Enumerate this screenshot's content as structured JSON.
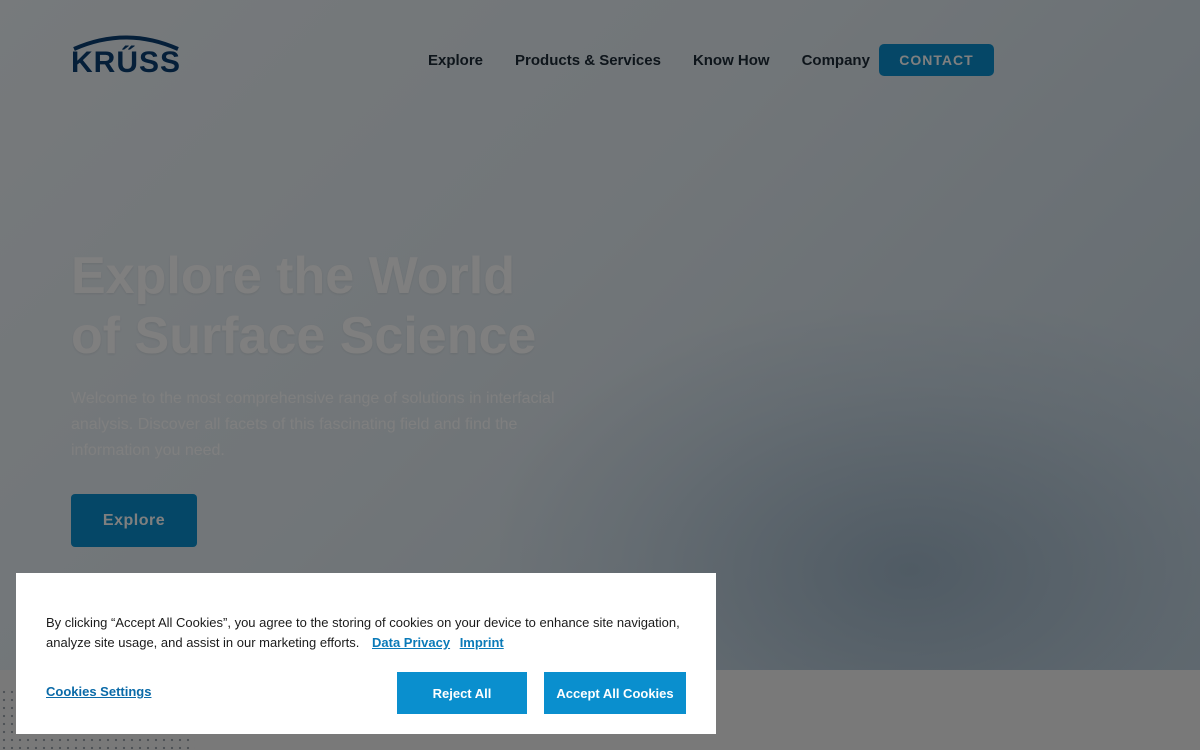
{
  "brand": {
    "logo_text": "KRŰSS"
  },
  "nav": {
    "items": [
      {
        "label": "Explore"
      },
      {
        "label": "Products & Services"
      },
      {
        "label": "Know How"
      },
      {
        "label": "Company"
      }
    ],
    "contact_label": "CONTACT"
  },
  "hero": {
    "title_line1": "Explore the World",
    "title_line2": "of Surface Science",
    "text": "Welcome to the most comprehensive range of solutions in interfacial analysis. Discover all facets of this fascinating field and find the information you need.",
    "button_label": "Explore"
  },
  "cookie": {
    "text": "By clicking “Accept All Cookies”, you agree to the storing of cookies on your device to enhance site navigation, analyze site usage, and assist in our marketing efforts.",
    "privacy_link": "Data Privacy",
    "imprint_link": "Imprint",
    "settings_label": "Cookies Settings",
    "reject_label": "Reject All",
    "accept_label": "Accept All Cookies"
  },
  "colors": {
    "accent": "#0a8fce",
    "logo": "#0b3f73",
    "nav_text": "#1d2a36"
  }
}
